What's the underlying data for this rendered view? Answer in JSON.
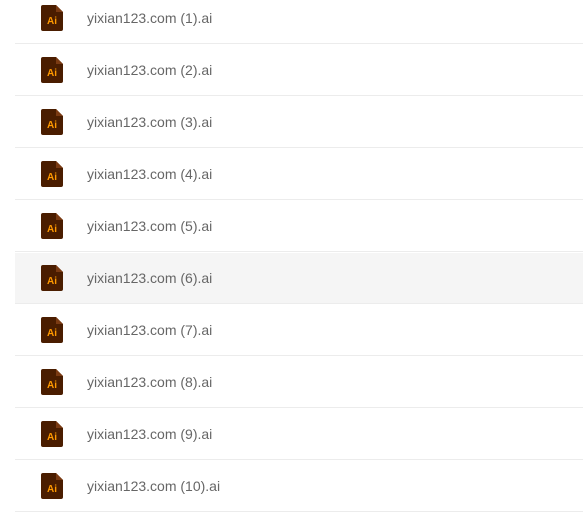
{
  "files": [
    {
      "name": "yixian123.com (1).ai"
    },
    {
      "name": "yixian123.com (2).ai"
    },
    {
      "name": "yixian123.com (3).ai"
    },
    {
      "name": "yixian123.com (4).ai"
    },
    {
      "name": "yixian123.com (5).ai"
    },
    {
      "name": "yixian123.com (6).ai"
    },
    {
      "name": "yixian123.com (7).ai"
    },
    {
      "name": "yixian123.com (8).ai"
    },
    {
      "name": "yixian123.com (9).ai"
    },
    {
      "name": "yixian123.com (10).ai"
    }
  ],
  "icon": {
    "type": "illustrator-file-icon",
    "label": "Ai",
    "background": "#4a1d00",
    "fold": "#7a3a12",
    "text_color": "#ff9a00"
  },
  "selected_index": 5,
  "colors": {
    "row_border": "#ececec",
    "selected_background": "#f5f5f5",
    "filename_text": "#666666"
  }
}
